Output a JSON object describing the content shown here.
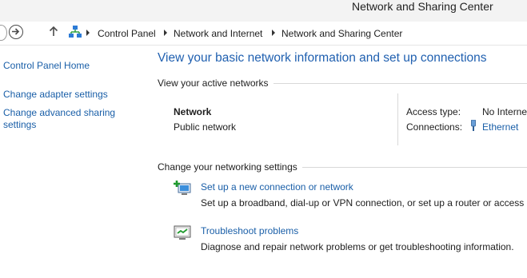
{
  "window": {
    "title": "Network and Sharing Center"
  },
  "breadcrumb": [
    "Control Panel",
    "Network and Internet",
    "Network and Sharing Center"
  ],
  "sidebar": {
    "items": [
      {
        "label": "Control Panel Home"
      },
      {
        "label": "Change adapter settings"
      },
      {
        "label": "Change advanced sharing"
      },
      {
        "label": "settings"
      }
    ]
  },
  "main": {
    "heading": "View your basic network information and set up connections",
    "active_networks_title": "View your active networks",
    "network": {
      "name": "Network",
      "type": "Public network"
    },
    "access_type_label": "Access type:",
    "access_type_value": "No Interne",
    "connections_label": "Connections:",
    "connections_value": "Ethernet",
    "settings_title": "Change your networking settings",
    "tasks": [
      {
        "icon": "new-connection-icon",
        "title": "Set up a new connection or network",
        "description": "Set up a broadband, dial-up or VPN connection, or set up a router or access p"
      },
      {
        "icon": "troubleshoot-icon",
        "title": "Troubleshoot problems",
        "description": "Diagnose and repair network problems or get troubleshooting information."
      }
    ]
  },
  "colors": {
    "link": "#1a5fa8",
    "heading": "#2060b0",
    "titlebar": "#f3f3f3"
  }
}
